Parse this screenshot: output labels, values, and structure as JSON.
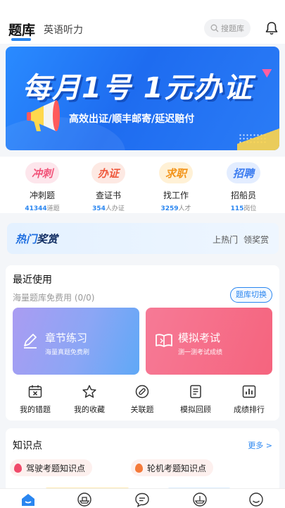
{
  "header": {
    "tab_active": "题库",
    "tab_other": "英语听力",
    "search_placeholder": "搜题库"
  },
  "banner": {
    "headline": "每月1号  1元办证",
    "subline": "高效出证/顺丰邮寄/延迟赔付"
  },
  "quick_entries": [
    {
      "badge": "冲刺",
      "name": "冲刺题",
      "count": "41344",
      "unit": "道题",
      "color": "#f2547a",
      "bg": "#fde6ec"
    },
    {
      "badge": "办证",
      "name": "查证书",
      "count": "354",
      "unit": "人办证",
      "color": "#ef5a3e",
      "bg": "#fde9e3"
    },
    {
      "badge": "求职",
      "name": "找工作",
      "count": "3259",
      "unit": "人才",
      "color": "#f2941a",
      "bg": "#fff1d6"
    },
    {
      "badge": "招聘",
      "name": "招船员",
      "count": "115",
      "unit": "岗位",
      "color": "#3d7df0",
      "bg": "#e3edff"
    }
  ],
  "hot": {
    "title_a": "热门",
    "title_b": "奖赏",
    "right_a": "上热门",
    "right_b": "领奖赏"
  },
  "recent": {
    "title": "最近使用",
    "subtitle": "海量题库免费用 (0/0)",
    "switch_label": "题库切换",
    "card_a": {
      "title": "章节练习",
      "desc": "海量真题免费刷"
    },
    "card_b": {
      "title": "模拟考试",
      "desc": "测一测考试成绩"
    },
    "tools": [
      {
        "label": "我的错题",
        "icon": "calendar-x-icon"
      },
      {
        "label": "我的收藏",
        "icon": "star-icon"
      },
      {
        "label": "关联题",
        "icon": "link-icon"
      },
      {
        "label": "模拟回顾",
        "icon": "document-icon"
      },
      {
        "label": "成绩排行",
        "icon": "bar-chart-icon"
      }
    ]
  },
  "knowledge": {
    "title": "知识点",
    "more": "更多 >",
    "items": [
      {
        "label": "驾驶考题知识点",
        "color": "#f04a6a"
      },
      {
        "label": "轮机考题知识点",
        "color": "#f47a3a"
      }
    ]
  },
  "bottom_nav": [
    "home-icon",
    "ship-icon",
    "chat-icon",
    "ship2-icon",
    "profile-icon"
  ]
}
